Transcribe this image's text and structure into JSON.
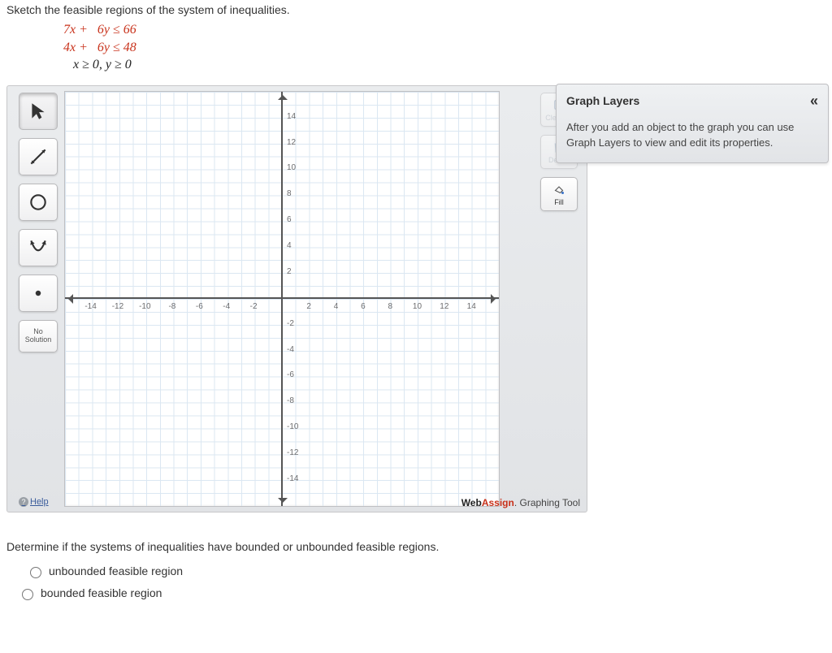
{
  "problem": {
    "prompt": "Sketch the feasible regions of the system of inequalities.",
    "equations": {
      "line1": "7x +   6y ≤ 66",
      "line2": "4x +   6y ≤ 48",
      "line3": "   x ≥ 0, y ≥ 0"
    }
  },
  "toolbar": {
    "no_solution_line1": "No",
    "no_solution_line2": "Solution",
    "help_label": "Help"
  },
  "actions": {
    "clear_all": "Clear All",
    "delete": "Delete",
    "fill": "Fill"
  },
  "axes": {
    "x_ticks": [
      "-14",
      "-12",
      "-10",
      "-8",
      "-6",
      "-4",
      "-2",
      "2",
      "4",
      "6",
      "8",
      "10",
      "12",
      "14"
    ],
    "y_ticks": [
      "14",
      "12",
      "10",
      "8",
      "6",
      "4",
      "2",
      "-2",
      "-4",
      "-6",
      "-8",
      "-10",
      "-12",
      "-14"
    ]
  },
  "chart_data": {
    "type": "scatter",
    "title": "",
    "xlabel": "",
    "ylabel": "",
    "xlim": [
      -16,
      16
    ],
    "ylim": [
      -16,
      16
    ],
    "grid": true,
    "series": []
  },
  "layers_panel": {
    "title": "Graph Layers",
    "body": "After you add an object to the graph you can use Graph Layers to view and edit its properties."
  },
  "brand": {
    "web": "Web",
    "assign": "Assign",
    "suffix": ". Graphing Tool"
  },
  "question2": {
    "prompt": "Determine if the systems of inequalities have bounded or unbounded feasible regions.",
    "option1": "unbounded feasible region",
    "option2": "bounded feasible region"
  }
}
